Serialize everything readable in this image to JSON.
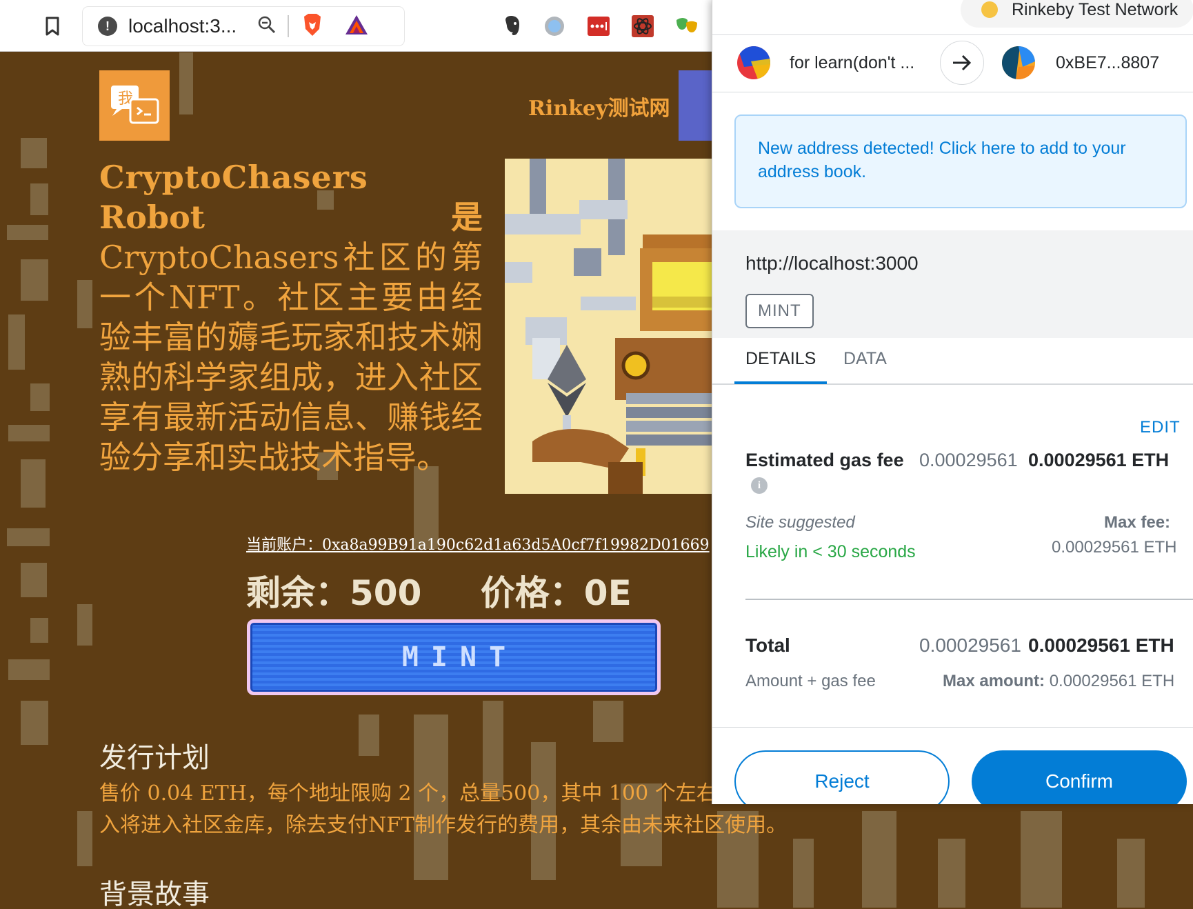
{
  "browser": {
    "url_text": "localhost:3...",
    "icons": [
      "bookmark-icon",
      "info-icon",
      "zoom-icon",
      "brave-shield-icon",
      "bat-icon",
      "evernote-icon",
      "circle-ext-icon",
      "lastpass-icon",
      "react-devtools-icon",
      "masks-icon"
    ]
  },
  "site": {
    "network_label": "Rinkey测试网",
    "intro_line1": "CryptoChasers",
    "intro_line2_left": "Robot",
    "intro_line2_right": "是",
    "intro_rest": "CryptoChasers社区的第一个NFT。社区主要由经验丰富的薅毛玩家和技术娴熟的科学家组成，进入社区享有最新活动信息、赚钱经验分享和实战技术指导。",
    "account_label": "当前账户：0xa8a99B91a190c62d1a63d5A0cf7f19982D01669",
    "remaining": "剩余：500",
    "price": "价格：0E",
    "mint_label": "MINT",
    "plan_heading": "发行计划",
    "plan_text": "售价 0.04 ETH，每个地址限购 2 个，总量500，其中 100 个左右",
    "plan_text2": "入将进入社区金库，除去支付NFT制作发行的费用，其余由未来社区使用。",
    "story_heading": "背景故事"
  },
  "metamask": {
    "network": "Rinkeby Test Network",
    "from_account": "for learn(don't ...",
    "to_address": "0xBE7...8807",
    "notice": "New address detected! Click here to add to your address book.",
    "origin": "http://localhost:3000",
    "method": "MINT",
    "tabs": [
      "DETAILS",
      "DATA"
    ],
    "edit": "EDIT",
    "gas_label": "Estimated gas fee",
    "gas_secondary": "0.00029561",
    "gas_primary": "0.00029561 ETH",
    "site_suggested": "Site suggested",
    "likely": "Likely in < 30 seconds",
    "max_fee_label": "Max fee:",
    "max_fee_value": "0.00029561 ETH",
    "total_label": "Total",
    "total_secondary": "0.00029561",
    "total_primary": "0.00029561 ETH",
    "amount_gas": "Amount + gas fee",
    "max_amount_label": "Max amount:",
    "max_amount_value": "0.00029561 ETH",
    "reject": "Reject",
    "confirm": "Confirm",
    "colors": {
      "accent": "#037dd6",
      "success": "#28a745",
      "network_dot": "#f6c343"
    }
  }
}
